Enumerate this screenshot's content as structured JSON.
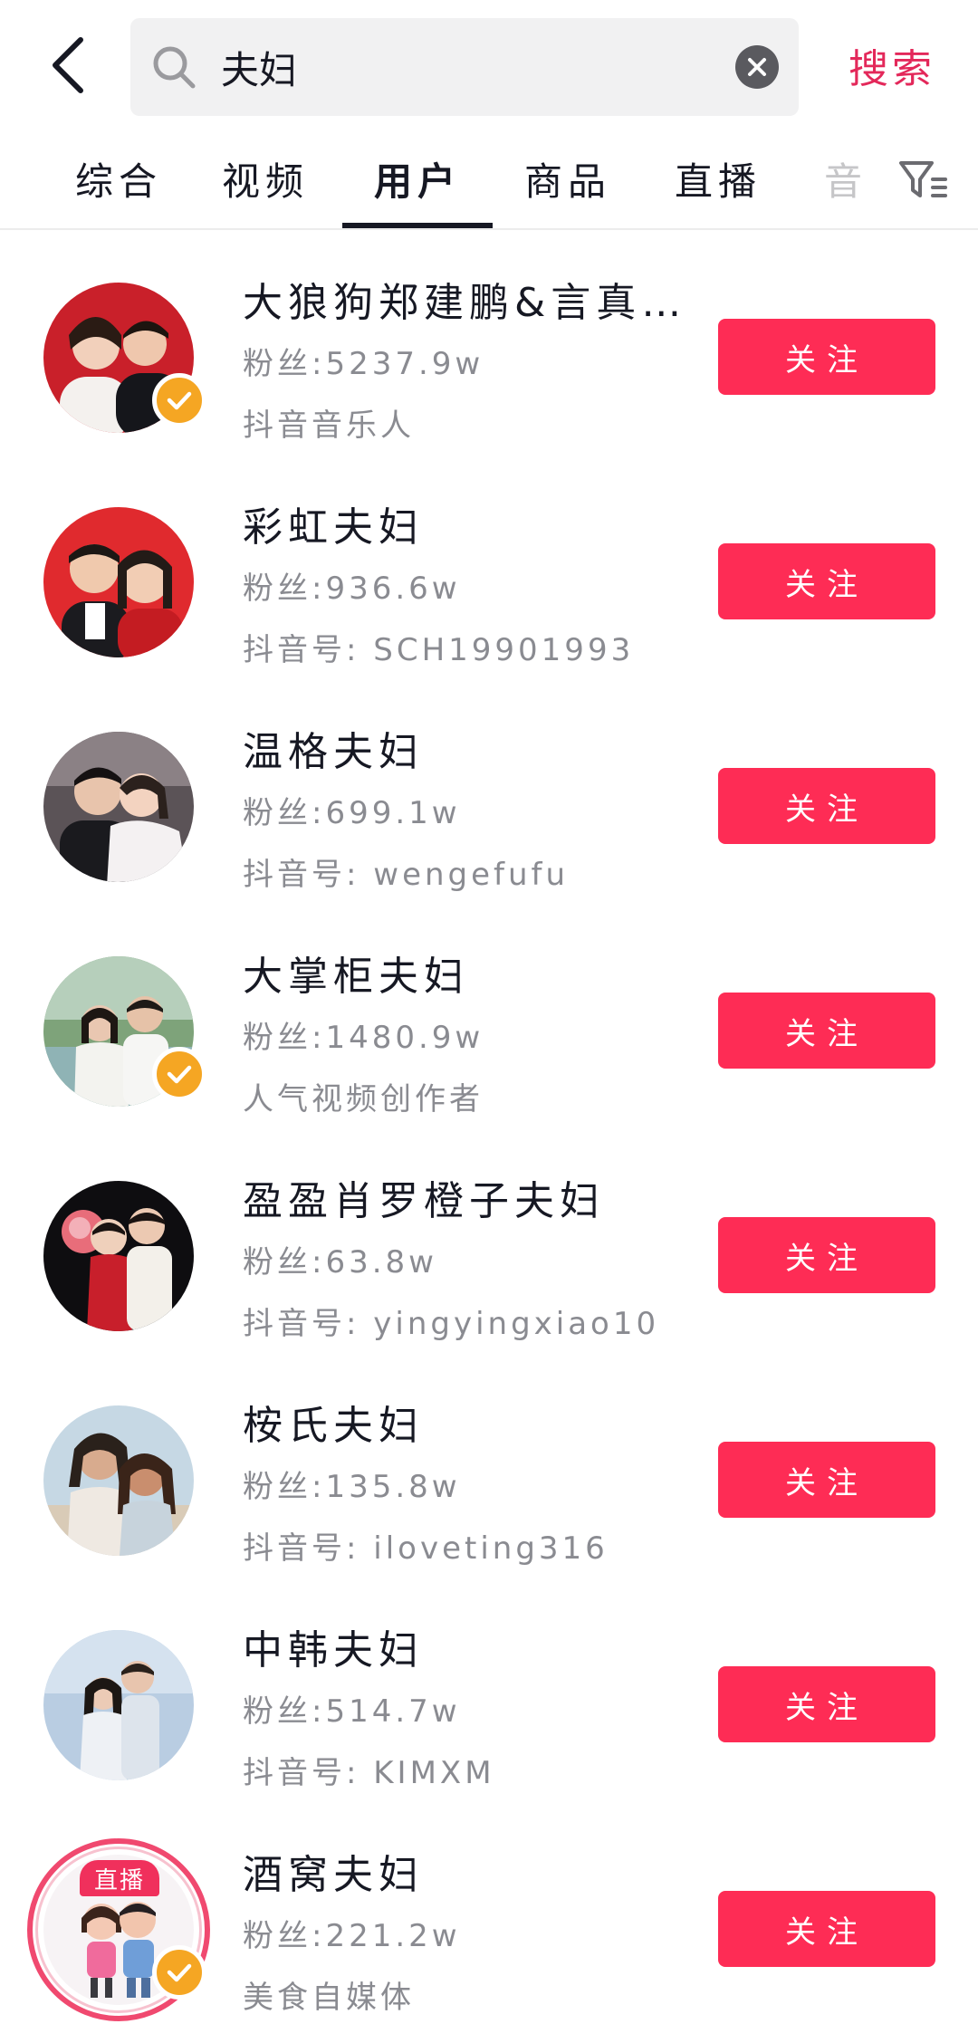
{
  "search": {
    "query": "夫妇",
    "submit_label": "搜索"
  },
  "tabs": [
    {
      "label": "综合"
    },
    {
      "label": "视频"
    },
    {
      "label": "用户"
    },
    {
      "label": "商品"
    },
    {
      "label": "直播"
    },
    {
      "label": "音"
    }
  ],
  "active_tab": "用户",
  "icons": {
    "back": "back-arrow-icon",
    "search": "search-icon",
    "clear": "clear-icon",
    "filter": "filter-icon",
    "verified": "verified-check-icon"
  },
  "colors": {
    "accent": "#fe2c55",
    "search_text": "#e3285a",
    "verified": "#f5a623",
    "secondary_text": "#8a8b91"
  },
  "users": [
    {
      "name": "大狼狗郑建鹏&言真…",
      "fans": "粉丝:5237.9w",
      "sub": "抖音音乐人",
      "verified": true,
      "live": false,
      "follow_label": "关注"
    },
    {
      "name": "彩虹夫妇",
      "fans": "粉丝:936.6w",
      "sub": "抖音号: SCH19901993",
      "verified": false,
      "live": false,
      "follow_label": "关注"
    },
    {
      "name": "温格夫妇",
      "fans": "粉丝:699.1w",
      "sub": "抖音号: wengefufu",
      "verified": false,
      "live": false,
      "follow_label": "关注"
    },
    {
      "name": "大掌柜夫妇",
      "fans": "粉丝:1480.9w",
      "sub": "人气视频创作者",
      "verified": true,
      "live": false,
      "follow_label": "关注"
    },
    {
      "name": "盈盈肖罗橙子夫妇",
      "fans": "粉丝:63.8w",
      "sub": "抖音号: yingyingxiao10",
      "verified": false,
      "live": false,
      "follow_label": "关注"
    },
    {
      "name": "桉氏夫妇",
      "fans": "粉丝:135.8w",
      "sub": "抖音号: iloveting316",
      "verified": false,
      "live": false,
      "follow_label": "关注"
    },
    {
      "name": "中韩夫妇",
      "fans": "粉丝:514.7w",
      "sub": "抖音号: KIMXM",
      "verified": false,
      "live": false,
      "follow_label": "关注"
    },
    {
      "name": "酒窝夫妇",
      "fans": "粉丝:221.2w",
      "sub": "美食自媒体",
      "verified": true,
      "live": true,
      "live_label": "直播",
      "follow_label": "关注"
    }
  ]
}
